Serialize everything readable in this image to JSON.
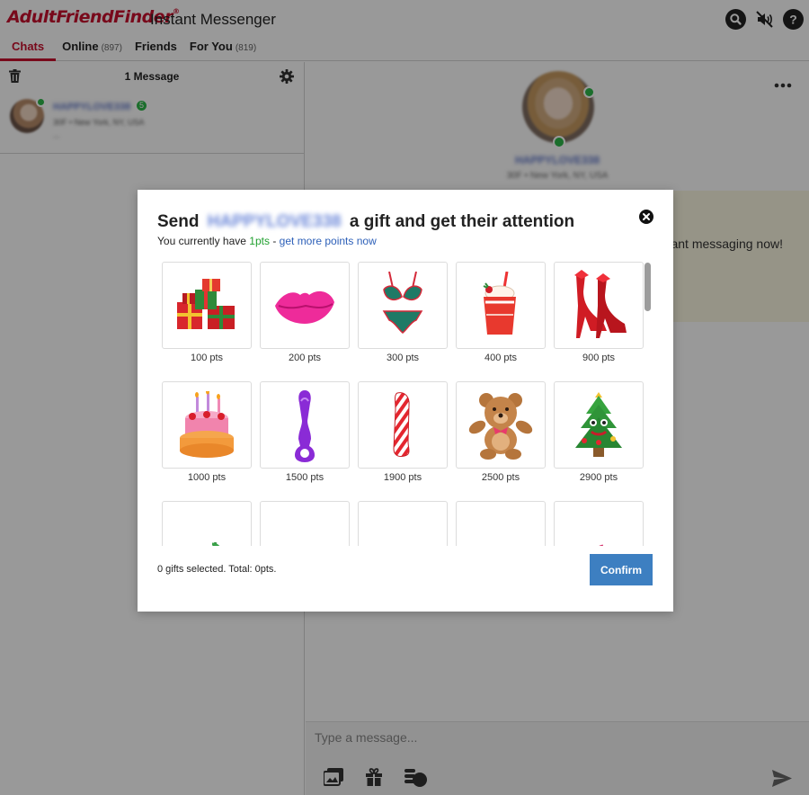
{
  "app": {
    "logo_text": "AdultFriendFinder",
    "logo_reg": "®",
    "title": "Instant Messenger"
  },
  "tabs": [
    {
      "label": "Chats",
      "count": ""
    },
    {
      "label": "Online",
      "count": "(897)"
    },
    {
      "label": "Friends",
      "count": ""
    },
    {
      "label": "For You",
      "count": "(819)"
    }
  ],
  "left_panel": {
    "message_count": "1 Message",
    "chat": {
      "name": "HAPPYLOVE338",
      "badge": "5",
      "subtitle": "30F • New York, NY, USA",
      "preview": "..."
    }
  },
  "profile": {
    "name": "HAPPYLOVE338",
    "subtitle": "30F • New York, NY, USA"
  },
  "banner": {
    "text": "ant messaging now!"
  },
  "compose": {
    "placeholder": "Type a message..."
  },
  "modal": {
    "title_prefix": "Send",
    "title_name": "HAPPYLOVE338",
    "title_suffix": "a gift and get their attention",
    "sub_prefix": "You currently have",
    "points": "1pts",
    "sub_sep": "-",
    "more_points_link": "get more points now",
    "selected_text": "0 gifts selected. Total: 0pts.",
    "confirm_label": "Confirm"
  },
  "gifts": [
    {
      "icon": "gift-boxes-icon",
      "price": "100 pts"
    },
    {
      "icon": "lips-icon",
      "price": "200 pts"
    },
    {
      "icon": "lingerie-icon",
      "price": "300 pts"
    },
    {
      "icon": "drink-icon",
      "price": "400 pts"
    },
    {
      "icon": "boots-icon",
      "price": "900 pts"
    },
    {
      "icon": "cake-icon",
      "price": "1000 pts"
    },
    {
      "icon": "purple-toy-icon",
      "price": "1500 pts"
    },
    {
      "icon": "candy-cane-toy-icon",
      "price": "1900 pts"
    },
    {
      "icon": "teddy-bear-icon",
      "price": "2500 pts"
    },
    {
      "icon": "christmas-tree-icon",
      "price": "2900 pts"
    },
    {
      "icon": "cocktail-icon",
      "price": ""
    },
    {
      "icon": "orchid-icon",
      "price": ""
    },
    {
      "icon": "santa-hat-icon",
      "price": ""
    },
    {
      "icon": "handbag-icon",
      "price": ""
    },
    {
      "icon": "whip-icon",
      "price": ""
    }
  ],
  "colors": {
    "brand_red": "#c8102e",
    "online_green": "#2eb84a",
    "confirm_blue": "#3d7fc1",
    "link_blue": "#2c5fb8",
    "points_green": "#21a02f"
  }
}
